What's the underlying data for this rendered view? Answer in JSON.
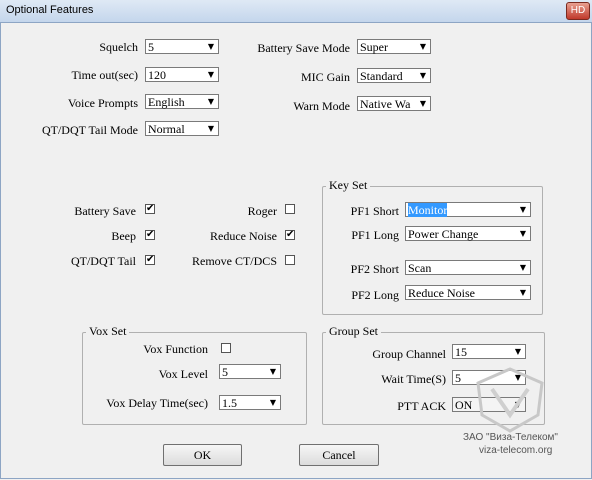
{
  "window": {
    "title": "Optional Features",
    "close_label": "HD"
  },
  "general": {
    "squelch": {
      "label": "Squelch",
      "value": "5"
    },
    "timeout": {
      "label": "Time out(sec)",
      "value": "120"
    },
    "voice_prompts": {
      "label": "Voice Prompts",
      "value": "English"
    },
    "tail_mode": {
      "label": "QT/DQT Tail Mode",
      "value": "Normal"
    },
    "battery_save_mode": {
      "label": "Battery Save Mode",
      "value": "Super"
    },
    "mic_gain": {
      "label": "MIC Gain",
      "value": "Standard"
    },
    "warn_mode": {
      "label": "Warn Mode",
      "value": "Native Wa"
    }
  },
  "checks": {
    "battery_save": {
      "label": "Battery Save",
      "checked": true
    },
    "beep": {
      "label": "Beep",
      "checked": true
    },
    "qt_dqt_tail": {
      "label": "QT/DQT Tail",
      "checked": true
    },
    "roger": {
      "label": "Roger",
      "checked": false
    },
    "reduce_noise": {
      "label": "Reduce Noise",
      "checked": true
    },
    "remove_ct_dcs": {
      "label": "Remove CT/DCS",
      "checked": false
    },
    "check_mark": "✔"
  },
  "key_set": {
    "title": "Key Set",
    "pf1_short": {
      "label": "PF1 Short",
      "value": "Monitor"
    },
    "pf1_long": {
      "label": "PF1 Long",
      "value": "Power Change"
    },
    "pf2_short": {
      "label": "PF2 Short",
      "value": "Scan"
    },
    "pf2_long": {
      "label": "PF2 Long",
      "value": "Reduce Noise"
    }
  },
  "vox_set": {
    "title": "Vox Set",
    "vox_function": {
      "label": "Vox Function",
      "checked": false
    },
    "vox_level": {
      "label": "Vox Level",
      "value": "5"
    },
    "vox_delay": {
      "label": "Vox Delay Time(sec)",
      "value": "1.5"
    }
  },
  "group_set": {
    "title": "Group Set",
    "group_channel": {
      "label": "Group Channel",
      "value": "15"
    },
    "wait_time": {
      "label": "Wait Time(S)",
      "value": "5"
    },
    "ptt_ack": {
      "label": "PTT ACK",
      "value": "ON"
    }
  },
  "buttons": {
    "ok": "OK",
    "cancel": "Cancel"
  },
  "watermark": {
    "line1": "ЗАО \"Виза-Телеком\"",
    "line2": "viza-telecom.org"
  },
  "arrow_glyph": "▼"
}
